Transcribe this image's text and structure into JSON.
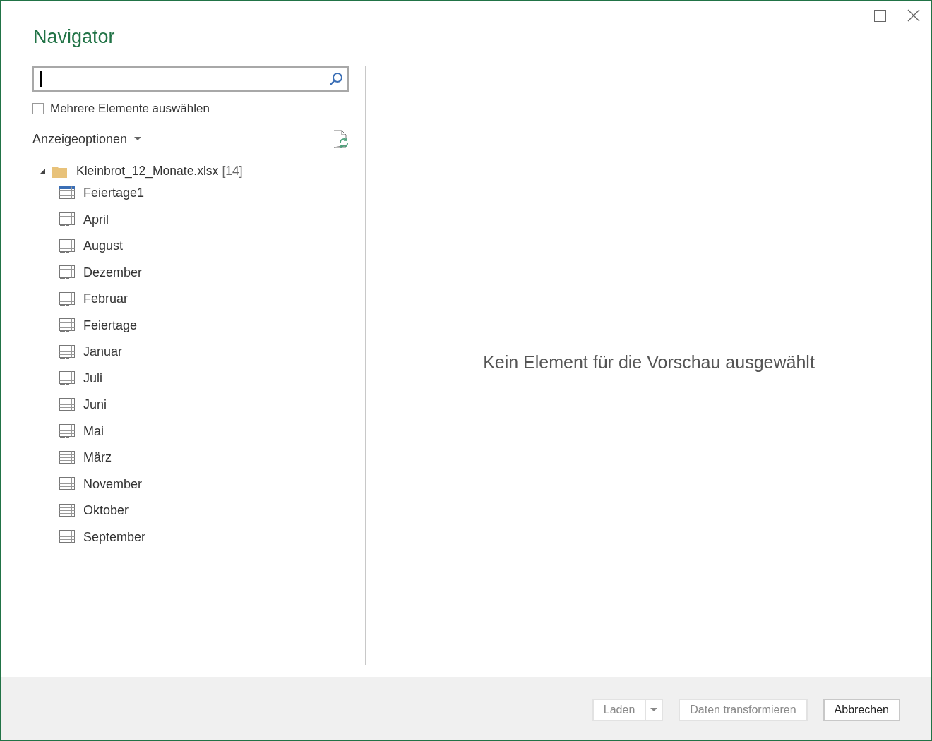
{
  "window": {
    "title": "Navigator"
  },
  "multi_select": {
    "label": "Mehrere Elemente auswählen",
    "checked": false
  },
  "display_options": {
    "label": "Anzeigeoptionen"
  },
  "tree": {
    "label": "Kleinbrot_12_Monate.xlsx",
    "count": "[14]",
    "expanded": true,
    "children": [
      {
        "label": "Feiertage1",
        "kind": "table",
        "selected": false
      },
      {
        "label": "April",
        "kind": "sheet",
        "selected": false
      },
      {
        "label": "August",
        "kind": "sheet",
        "selected": false
      },
      {
        "label": "Dezember",
        "kind": "sheet",
        "selected": false
      },
      {
        "label": "Februar",
        "kind": "sheet",
        "selected": false
      },
      {
        "label": "Feiertage",
        "kind": "sheet",
        "selected": false
      },
      {
        "label": "Januar",
        "kind": "sheet",
        "selected": false
      },
      {
        "label": "Juli",
        "kind": "sheet",
        "selected": false
      },
      {
        "label": "Juni",
        "kind": "sheet",
        "selected": false
      },
      {
        "label": "Mai",
        "kind": "sheet",
        "selected": false
      },
      {
        "label": "März",
        "kind": "sheet",
        "selected": false
      },
      {
        "label": "November",
        "kind": "sheet",
        "selected": false
      },
      {
        "label": "Oktober",
        "kind": "sheet",
        "selected": false
      },
      {
        "label": "September",
        "kind": "sheet",
        "selected": false
      }
    ]
  },
  "preview": {
    "message": "Kein Element für die Vorschau ausgewählt"
  },
  "buttons": [
    {
      "label": "Laden",
      "kind": "split",
      "disabled": true
    },
    {
      "label": "Daten transformieren",
      "kind": "plain",
      "disabled": true
    },
    {
      "label": "Abbrechen",
      "kind": "plain",
      "disabled": false
    }
  ]
}
